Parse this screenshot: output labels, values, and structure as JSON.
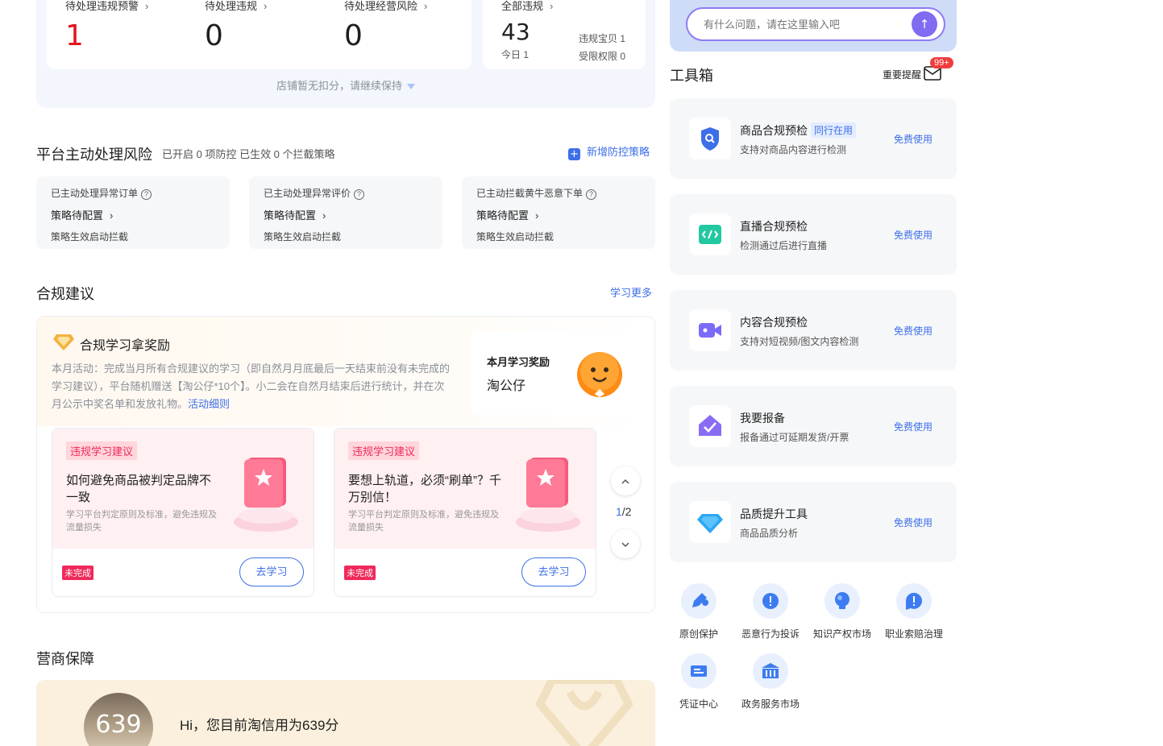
{
  "stats": {
    "pending_warning": {
      "label": "待处理违规预警",
      "value": "1"
    },
    "pending_violation": {
      "label": "待处理违规",
      "value": "0"
    },
    "pending_business_risk": {
      "label": "待处理经营风险",
      "value": "0"
    },
    "all_violations": {
      "label": "全部违规",
      "value": "43",
      "today": "今日 1",
      "item_violation": "违规宝贝 1",
      "restricted": "受限权限 0"
    },
    "notice": "店铺暂无扣分，请继续保持",
    "chevron": "›"
  },
  "platform_risk": {
    "title": "平台主动处理风险",
    "summary": "已开启 0 项防控 已生效 0 个拦截策略",
    "add_strategy": "新增防控策略",
    "add_icon": "+",
    "cards": [
      {
        "title": "已主动处理异常订单",
        "status": "策略待配置",
        "note": "策略生效启动拦截"
      },
      {
        "title": "已主动处理异常评价",
        "status": "策略待配置",
        "note": "策略生效启动拦截"
      },
      {
        "title": "已主动拦截黄牛恶意下单",
        "status": "策略待配置",
        "note": "策略生效启动拦截"
      }
    ],
    "help_icon": "?"
  },
  "compliance": {
    "title": "合规建议",
    "learn_more": "学习更多",
    "banner_title": "合规学习拿奖励",
    "banner_desc": "本月活动：完成当月所有合规建议的学习（即自然月月底最后一天结束前没有未完成的学习建议），平台随机赠送【淘公仔*10个】。小二会在自然月结束后进行统计，并在次月公示中奖名单和发放礼物。",
    "banner_link": "活动细则",
    "reward_label": "本月学习奖励",
    "reward_name": "淘公仔",
    "cards": [
      {
        "tag": "违规学习建议",
        "title": "如何避免商品被判定品牌不一致",
        "desc": "学习平台判定原则及标准，避免违规及流量损失",
        "status": "未完成",
        "button": "去学习"
      },
      {
        "tag": "违规学习建议",
        "title": "要想上轨道，必须“刷单”？千万别信！",
        "desc": "学习平台判定原则及标准，避免违规及流量损失",
        "status": "未完成",
        "button": "去学习"
      }
    ],
    "pager": {
      "current": "1",
      "total": "/2"
    }
  },
  "guarantee": {
    "title": "营商保障",
    "score": "639",
    "message": "Hi，您目前淘信用为639分"
  },
  "assistant": {
    "placeholder": "有什么问题，请在这里输入吧",
    "send_icon": "↑"
  },
  "toolbox": {
    "title": "工具箱",
    "reminder": "重要提醒",
    "badge": "99+",
    "tools": [
      {
        "name": "商品合规预检",
        "badge": "同行在用",
        "sub": "支持对商品内容进行检测",
        "action": "免费使用",
        "icon": "shield-search-icon"
      },
      {
        "name": "直播合规预检",
        "badge": "",
        "sub": "检测通过后进行直播",
        "action": "免费使用",
        "icon": "code-icon"
      },
      {
        "name": "内容合规预检",
        "badge": "",
        "sub": "支持对短视频/图文内容检测",
        "action": "免费使用",
        "icon": "video-icon"
      },
      {
        "name": "我要报备",
        "badge": "",
        "sub": "报备通过可延期发货/开票",
        "action": "免费使用",
        "icon": "check-envelope-icon"
      },
      {
        "name": "品质提升工具",
        "badge": "",
        "sub": "商品品质分析",
        "action": "免费使用",
        "icon": "diamond-icon"
      }
    ],
    "mini_tools": [
      {
        "label": "原创保护",
        "icon": "original-protect-icon"
      },
      {
        "label": "恶意行为投诉",
        "icon": "complaint-icon"
      },
      {
        "label": "知识产权市场",
        "icon": "ip-market-icon"
      },
      {
        "label": "职业索赔治理",
        "icon": "claim-icon"
      },
      {
        "label": "凭证中心",
        "icon": "voucher-icon"
      },
      {
        "label": "政务服务市场",
        "icon": "gov-service-icon"
      }
    ]
  },
  "colors": {
    "accent": "#3d6fe8",
    "danger": "#e3141d",
    "pink": "#f0295a",
    "purple": "#7f6cf0"
  }
}
